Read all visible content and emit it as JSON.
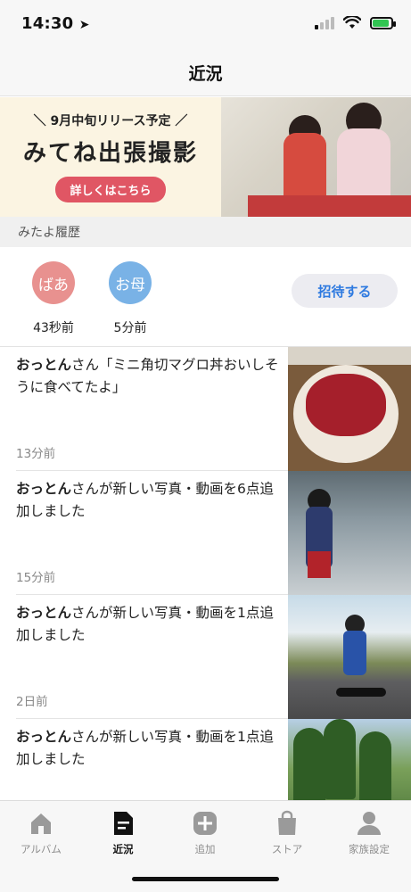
{
  "status_bar": {
    "time": "14:30"
  },
  "header": {
    "title": "近況"
  },
  "banner": {
    "pre_text": "＼ 9月中旬リリース予定 ／",
    "title": "みてね出張撮影",
    "button_label": "詳しくはこちら"
  },
  "visit_history": {
    "section_title": "みたよ履歴",
    "visitors": [
      {
        "name": "ばあ",
        "time": "43秒前",
        "color": "#e8918f"
      },
      {
        "name": "お母",
        "time": "5分前",
        "color": "#79b2e6"
      }
    ],
    "invite_label": "招待する"
  },
  "feed": [
    {
      "user": "おっとん",
      "text": "さん「ミニ角切マグロ丼おいしそうに食べてたよ」",
      "time": "13分前"
    },
    {
      "user": "おっとん",
      "text": "さんが新しい写真・動画を6点追加しました",
      "time": "15分前"
    },
    {
      "user": "おっとん",
      "text": "さんが新しい写真・動画を1点追加しました",
      "time": "2日前"
    },
    {
      "user": "おっとん",
      "text": "さんが新しい写真・動画を1点追加しました",
      "time": ""
    }
  ],
  "tabs": [
    {
      "label": "アルバム",
      "icon": "home-icon",
      "active": false
    },
    {
      "label": "近況",
      "icon": "document-icon",
      "active": true
    },
    {
      "label": "追加",
      "icon": "plus-icon",
      "active": false
    },
    {
      "label": "ストア",
      "icon": "bag-icon",
      "active": false
    },
    {
      "label": "家族設定",
      "icon": "person-icon",
      "active": false
    }
  ],
  "colors": {
    "accent_blue": "#2e7ae0",
    "banner_button": "#e05664",
    "battery_green": "#31c552"
  }
}
